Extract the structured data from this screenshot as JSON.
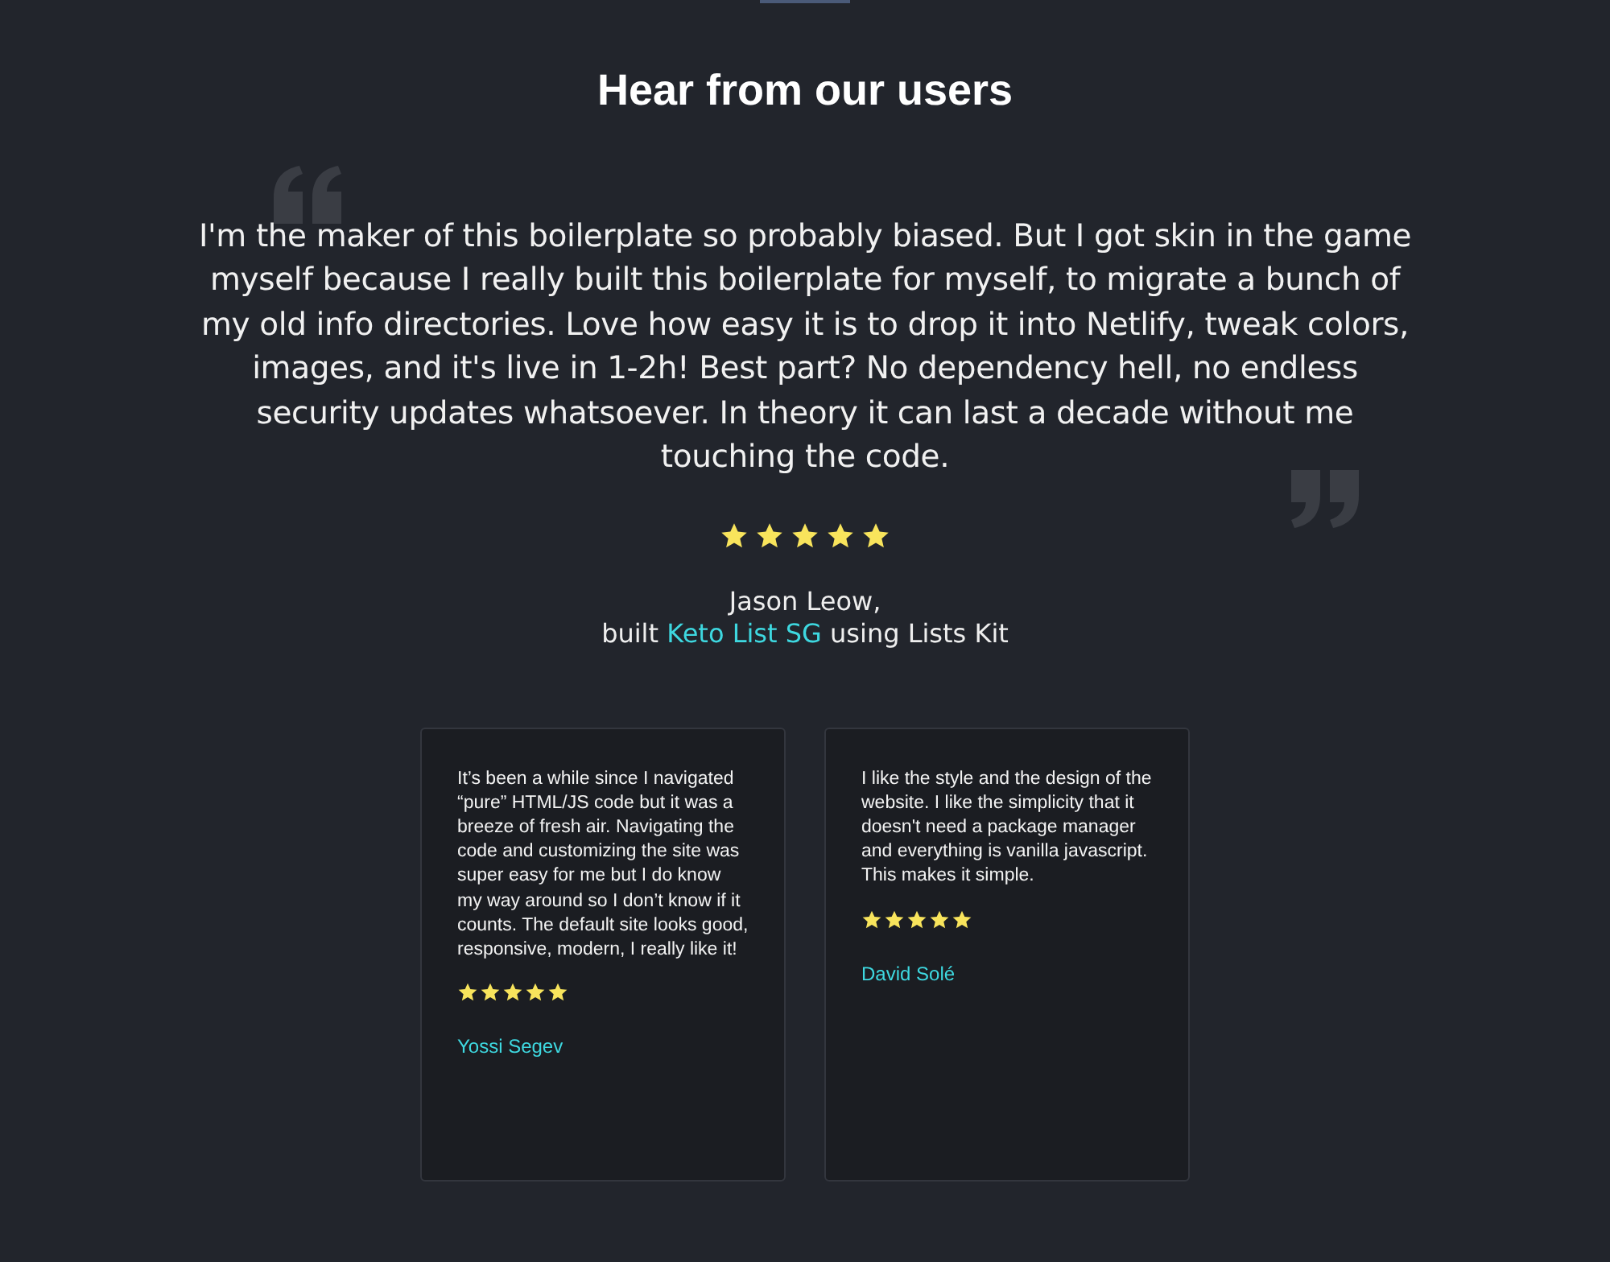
{
  "section": {
    "title": "Hear from our users"
  },
  "featured": {
    "quote": "I'm the maker of this boilerplate so probably biased. But I got skin in the game myself because I really built this boilerplate for myself, to migrate a bunch of my old info directories. Love how easy it is to drop it into Netlify, tweak colors, images, and it's live in 1-2h! Best part? No dependency hell, no endless security updates whatsoever. In theory it can last a decade without me touching the code.",
    "stars": 5,
    "author": "Jason Leow,",
    "byline_before": "built",
    "link": "Keto List SG",
    "byline_after": "using Lists Kit"
  },
  "testimonials": [
    {
      "quote": "It’s been a while since I navigated “pure” HTML/JS code but it was a breeze of fresh air. Navigating the code and customizing the site was super easy for me but I do know my way around so I don’t know if it counts. The default site looks good, responsive, modern, I really like it!",
      "stars": 5,
      "author": "Yossi Segev"
    },
    {
      "quote": "I like the style and the design of the website. I like the simplicity that it doesn't need a package manager and everything is vanilla javascript. This makes it simple.",
      "stars": 5,
      "author": "David Solé"
    }
  ]
}
